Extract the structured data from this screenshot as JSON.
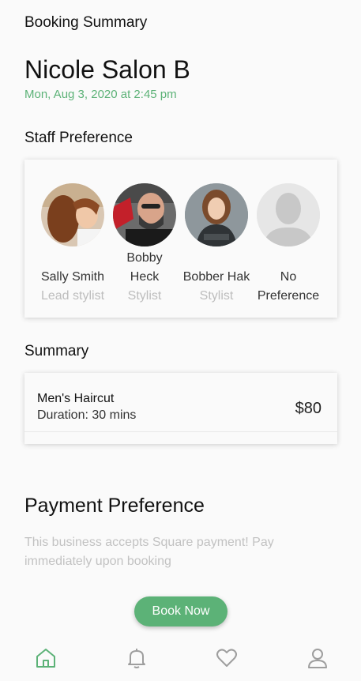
{
  "header": {
    "title": "Booking Summary"
  },
  "salon": {
    "name": "Nicole Salon B",
    "date": "Mon, Aug 3, 2020 at 2:45 pm"
  },
  "colors": {
    "accent": "#5cb277",
    "muted": "#bdbdbd"
  },
  "staff_section": {
    "title": "Staff Preference",
    "staff": [
      {
        "name": "Sally Smith",
        "role": "Lead stylist",
        "avatar_icon": "stylist-photo"
      },
      {
        "name": "Bobby Heck",
        "role": "Stylist",
        "avatar_icon": "stylist-photo"
      },
      {
        "name": "Bobber Hak",
        "role": "Stylist",
        "avatar_icon": "stylist-photo"
      },
      {
        "name": "No Preference",
        "role": "",
        "avatar_icon": "person-placeholder-icon"
      }
    ]
  },
  "summary": {
    "title": "Summary",
    "service": {
      "name": "Men's Haircut",
      "duration": "Duration: 30 mins",
      "price": "$80"
    }
  },
  "payment": {
    "title": "Payment Preference",
    "description": "This business accepts Square payment! Pay immediately upon booking"
  },
  "actions": {
    "book_label": "Book Now"
  },
  "nav": {
    "items": [
      {
        "icon": "home-icon",
        "active": true
      },
      {
        "icon": "bell-icon",
        "active": false
      },
      {
        "icon": "heart-icon",
        "active": false
      },
      {
        "icon": "profile-icon",
        "active": false
      }
    ]
  }
}
